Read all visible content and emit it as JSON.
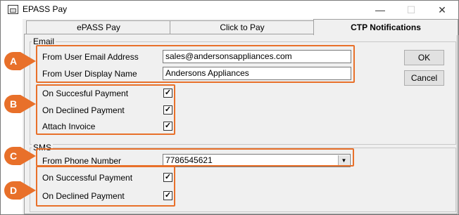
{
  "window": {
    "title": "EPASS Pay",
    "controls": [
      "—",
      "☐",
      "✕"
    ]
  },
  "tabs": [
    {
      "label": "ePASS Pay",
      "active": false
    },
    {
      "label": "Click to Pay",
      "active": false
    },
    {
      "label": "CTP Notifications",
      "active": true
    }
  ],
  "email": {
    "group_title": "Email",
    "from_address_label": "From User Email Address",
    "from_address_value": "sales@andersonsappliances.com",
    "display_name_label": "From User Display Name",
    "display_name_value": "Andersons Appliances",
    "checks": [
      {
        "label": "On Succesful Payment",
        "checked": true
      },
      {
        "label": "On Declined Payment",
        "checked": true
      },
      {
        "label": "Attach Invoice",
        "checked": true
      }
    ]
  },
  "sms": {
    "group_title": "SMS",
    "phone_label": "From Phone Number",
    "phone_value": "7786545621",
    "checks": [
      {
        "label": "On Successful Payment",
        "checked": true
      },
      {
        "label": "On Declined Payment",
        "checked": true
      }
    ]
  },
  "buttons": {
    "ok": "OK",
    "cancel": "Cancel"
  },
  "markers": [
    "A",
    "B",
    "C",
    "D"
  ],
  "colors": {
    "highlight": "#e8702a",
    "marker": "#e8702a",
    "panel": "#f0f0f0"
  },
  "check_glyph": "✓"
}
